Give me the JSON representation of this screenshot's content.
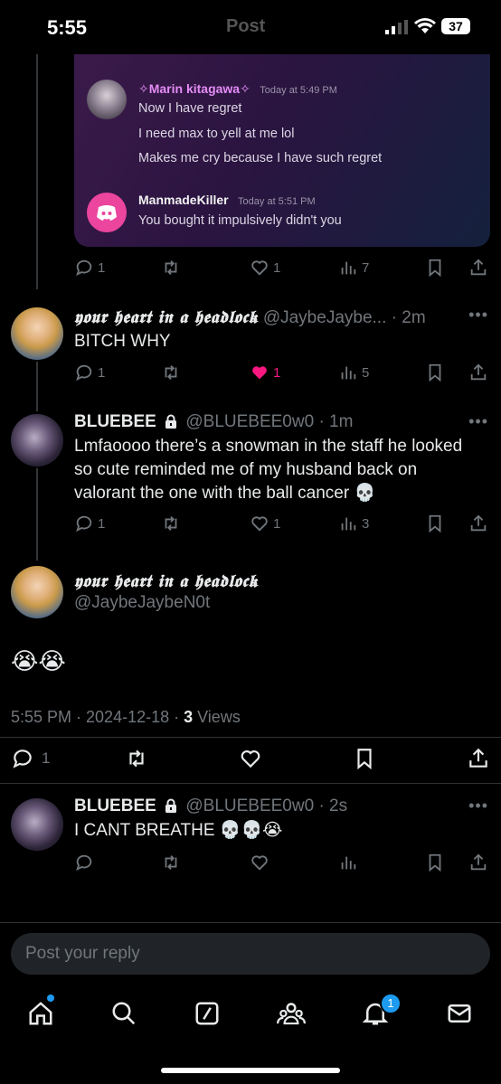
{
  "status_bar": {
    "time": "5:55",
    "battery": "37"
  },
  "header": {
    "title": "Post"
  },
  "embed": {
    "messages": [
      {
        "author": "✧Marin kitagawa✧",
        "time": "Today at 5:49 PM",
        "lines": [
          "Now I have regret",
          "I need max to yell at me lol",
          "Makes me cry because I have such regret"
        ]
      },
      {
        "author": "ManmadeKiller",
        "time": "Today at 5:51 PM",
        "lines": [
          "You bought it impulsively didn't you"
        ]
      }
    ]
  },
  "post1_actions": {
    "replies": "1",
    "likes": "1",
    "views": "7"
  },
  "reply1": {
    "name": "𝖞𝖔𝖚𝖗 𝖍𝖊𝖆𝖗𝖙 𝖎𝖓 𝖆 𝖍𝖊𝖆𝖉𝖑𝖔𝖈𝖐",
    "handle": "@JaybeJaybe...",
    "time": "· 2m",
    "text": "BITCH WHY",
    "replies": "1",
    "likes": "1",
    "views": "5"
  },
  "reply2": {
    "name": "BLUEBEE",
    "handle": "@BLUEBEE0w0",
    "time": "· 1m",
    "text": "Lmfaoooo there’s a snowman in the staff he looked so cute reminded me of my husband back on valorant the one with the ball cancer 💀",
    "replies": "1",
    "likes": "1",
    "views": "3"
  },
  "main_post": {
    "name": "𝖞𝖔𝖚𝖗 𝖍𝖊𝖆𝖗𝖙 𝖎𝖓 𝖆 𝖍𝖊𝖆𝖉𝖑𝖔𝖈𝖐",
    "handle": "@JaybeJaybeN0t",
    "text": "😭😭",
    "meta_time": "5:55 PM · 2024-12-18 · ",
    "views_count": "3",
    "views_label": " Views",
    "replies": "1"
  },
  "reply3": {
    "name": "BLUEBEE",
    "handle": "@BLUEBEE0w0",
    "time": "· 2s",
    "text": "I CANT BREATHE 💀💀😭"
  },
  "composer": {
    "placeholder": "Post your reply"
  },
  "bottom_nav": {
    "notifications_badge": "1"
  },
  "colors": {
    "like_pink": "#f91880",
    "accent_blue": "#1d9bf0",
    "discord_pink": "#eb459e"
  }
}
